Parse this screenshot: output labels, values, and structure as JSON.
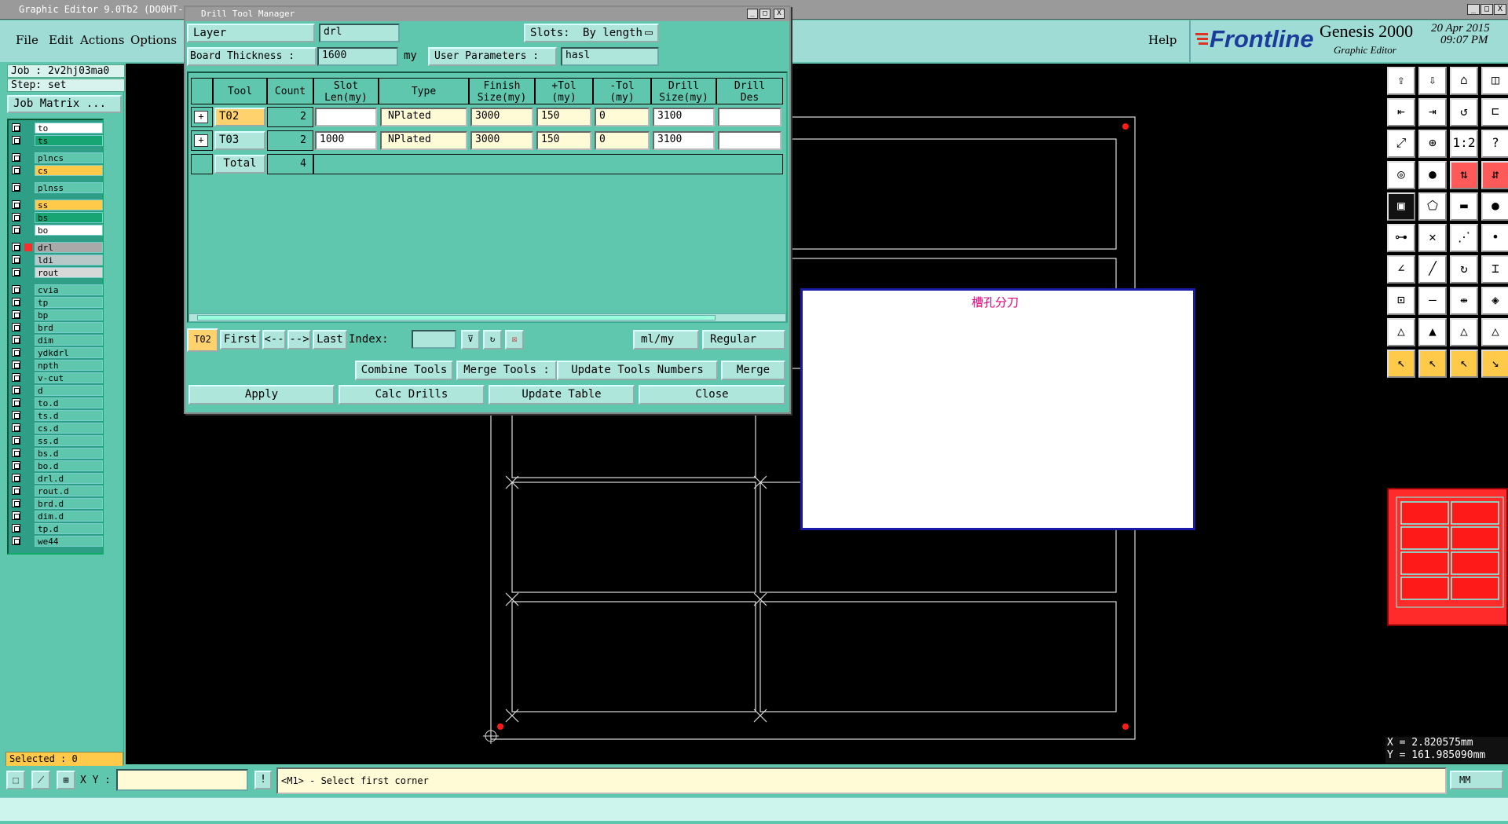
{
  "window": {
    "title": "Graphic Editor 9.0Tb2  (DO0HT-N",
    "min": "_",
    "max": "□",
    "close": "X"
  },
  "menu": {
    "file": "File",
    "edit": "Edit",
    "actions": "Actions",
    "options": "Options",
    "help": "Help"
  },
  "branding": {
    "company": "Frontline",
    "product": "Genesis 2000",
    "subtitle": "Graphic Editor",
    "date": "20 Apr 2015",
    "time": "09:07 PM"
  },
  "left": {
    "job": "Job : 2v2hj03ma0",
    "step": "Step: set",
    "job_matrix": "Job Matrix ...",
    "selected": "Selected : 0",
    "layers": [
      {
        "name": "to",
        "color": "#ffffff"
      },
      {
        "name": "ts",
        "color": "#17a673"
      },
      {
        "name": "plncs",
        "color": "#5fc7ae"
      },
      {
        "name": "cs",
        "color": "#ffc94a"
      },
      {
        "name": "plnss",
        "color": "#5fc7ae"
      },
      {
        "name": "ss",
        "color": "#ffc94a"
      },
      {
        "name": "bs",
        "color": "#17a673"
      },
      {
        "name": "bo",
        "color": "#ffffff"
      },
      {
        "name": "drl",
        "color": "#a9a9a9"
      },
      {
        "name": "ldi",
        "color": "#b8c8c8"
      },
      {
        "name": "rout",
        "color": "#d8d8d8"
      },
      {
        "name": "cvia",
        "color": "#5fc7ae"
      },
      {
        "name": "tp",
        "color": "#5fc7ae"
      },
      {
        "name": "bp",
        "color": "#5fc7ae"
      },
      {
        "name": "brd",
        "color": "#5fc7ae"
      },
      {
        "name": "dim",
        "color": "#5fc7ae"
      },
      {
        "name": "ydkdrl",
        "color": "#5fc7ae"
      },
      {
        "name": "npth",
        "color": "#5fc7ae"
      },
      {
        "name": "v-cut",
        "color": "#5fc7ae"
      },
      {
        "name": "d",
        "color": "#5fc7ae"
      },
      {
        "name": "to.d",
        "color": "#5fc7ae"
      },
      {
        "name": "ts.d",
        "color": "#5fc7ae"
      },
      {
        "name": "cs.d",
        "color": "#5fc7ae"
      },
      {
        "name": "ss.d",
        "color": "#5fc7ae"
      },
      {
        "name": "bs.d",
        "color": "#5fc7ae"
      },
      {
        "name": "bo.d",
        "color": "#5fc7ae"
      },
      {
        "name": "drl.d",
        "color": "#5fc7ae"
      },
      {
        "name": "rout.d",
        "color": "#5fc7ae"
      },
      {
        "name": "brd.d",
        "color": "#5fc7ae"
      },
      {
        "name": "dim.d",
        "color": "#5fc7ae"
      },
      {
        "name": "tp.d",
        "color": "#5fc7ae"
      },
      {
        "name": "we44",
        "color": "#5fc7ae"
      }
    ]
  },
  "dialog": {
    "title": "Drill Tool Manager",
    "layer_label": "Layer                :",
    "layer_value": "drl",
    "slots_label": "Slots:",
    "slots_value": "By length",
    "board_thickness_label": "Board Thickness :",
    "board_thickness_value": "1600",
    "thickness_unit": "my",
    "user_params_label": "User Parameters :",
    "user_params_value": "hasl",
    "columns": [
      "Tool",
      "Count",
      "Slot\nLen(my)",
      "Type",
      "Finish\nSize(my)",
      "+Tol\n(my)",
      "-Tol\n(my)",
      "Drill\nSize(my)",
      "Drill\nDes"
    ],
    "rows": [
      {
        "tool": "T02",
        "count": "2",
        "slot_len": "",
        "type": "NPlated",
        "finish": "3000",
        "ptol": "150",
        "mtol": "0",
        "drill": "3100",
        "des": ""
      },
      {
        "tool": "T03",
        "count": "2",
        "slot_len": "1000",
        "type": "NPlated",
        "finish": "3000",
        "ptol": "150",
        "mtol": "0",
        "drill": "3100",
        "des": ""
      }
    ],
    "total_label": "Total",
    "total_count": "4",
    "current_tool": "T02",
    "nav": {
      "first": "First",
      "prev": "<--",
      "next": "-->",
      "last": "Last",
      "index_label": "Index:",
      "index_value": ""
    },
    "units": "ml/my",
    "mode": "Regular",
    "combine": "Combine Tools",
    "merge_label": "Merge Tools :",
    "update_numbers": "Update Tools Numbers",
    "merge": "Merge",
    "apply": "Apply",
    "calc": "Calc Drills",
    "update_table": "Update Table",
    "close": "Close"
  },
  "popup": {
    "text": "槽孔分刀"
  },
  "coords": {
    "x": "X = 2.820575mm",
    "y": "Y = 161.985090mm"
  },
  "bottom": {
    "xy_label": "X Y :",
    "xy_value": "",
    "prompt": "<M1> - Select first corner",
    "units": "MM",
    "message": ""
  },
  "colors": {
    "accent": "#5fc7ae",
    "highlight": "#ffc94a",
    "pad": "#ff0000"
  }
}
